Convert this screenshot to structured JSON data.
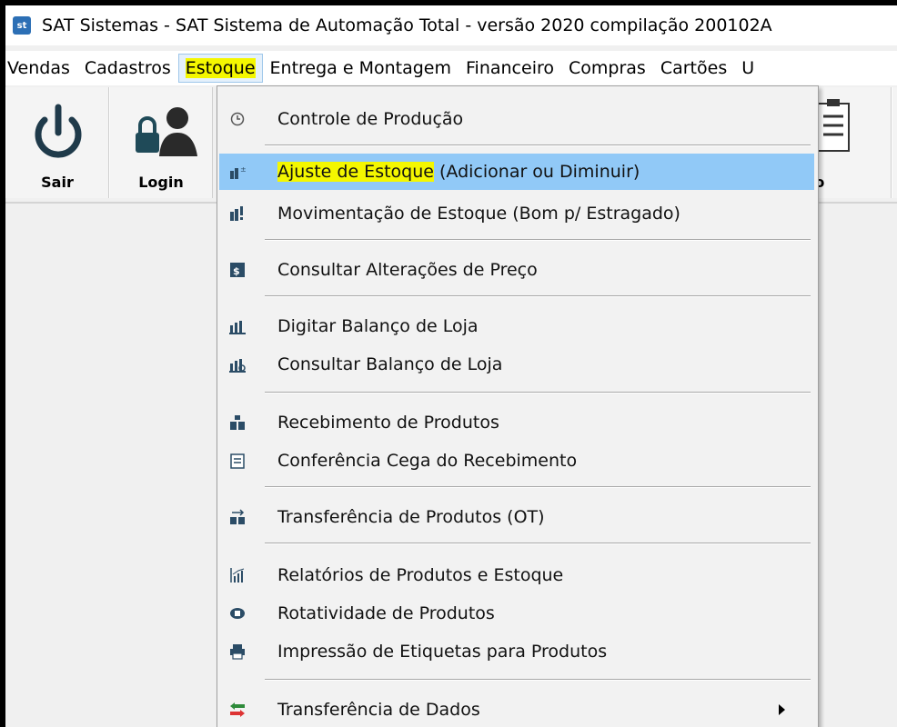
{
  "window": {
    "title": "SAT Sistemas - SAT Sistema de Automação Total - versão 2020 compilação 200102A",
    "app_icon": "sat-logo-icon"
  },
  "menubar": {
    "items": [
      {
        "label": "Vendas"
      },
      {
        "label": "Cadastros"
      },
      {
        "label": "Estoque",
        "active": true
      },
      {
        "label": "Entrega e Montagem"
      },
      {
        "label": "Financeiro"
      },
      {
        "label": "Compras"
      },
      {
        "label": "Cartões"
      },
      {
        "label": "U"
      }
    ]
  },
  "toolbar": {
    "buttons": [
      {
        "label": "Sair",
        "icon": "power-icon"
      },
      {
        "label": "Login",
        "icon": "user-lock-icon"
      },
      {
        "label": "dido",
        "icon": "clipboard-list-icon"
      },
      {
        "label": "",
        "icon": "unknown"
      }
    ]
  },
  "dropdown": {
    "items": [
      {
        "label": "Controle de Produção",
        "icon": "clock-icon"
      },
      {
        "label_main": "Ajuste de Estoque",
        "label_rest": " (Adicionar ou Diminuir)",
        "icon": "stock-adjust-icon",
        "selected": true
      },
      {
        "label": "Movimentação de Estoque (Bom p/ Estragado)",
        "icon": "stock-move-icon"
      },
      {
        "label": "Consultar Alterações de Preço",
        "icon": "price-query-icon"
      },
      {
        "label": "Digitar Balanço de Loja",
        "icon": "balance-entry-icon"
      },
      {
        "label": "Consultar Balanço de Loja",
        "icon": "balance-query-icon"
      },
      {
        "label": "Recebimento de Produtos",
        "icon": "receiving-icon"
      },
      {
        "label": "Conferência Cega do Recebimento",
        "icon": "blind-check-icon"
      },
      {
        "label": "Transferência de Produtos (OT)",
        "icon": "transfer-icon"
      },
      {
        "label": "Relatórios de Produtos e Estoque",
        "icon": "report-chart-icon"
      },
      {
        "label": "Rotatividade de Produtos",
        "icon": "rotation-icon"
      },
      {
        "label": "Impressão de Etiquetas para Produtos",
        "icon": "printer-icon"
      },
      {
        "label": "Transferência de Dados",
        "icon": "data-transfer-icon",
        "submenu": true
      }
    ]
  },
  "colors": {
    "highlight_yellow": "#f4f700",
    "selection_blue": "#91c9f7",
    "toolbar_icon": "#1f3a4a"
  }
}
